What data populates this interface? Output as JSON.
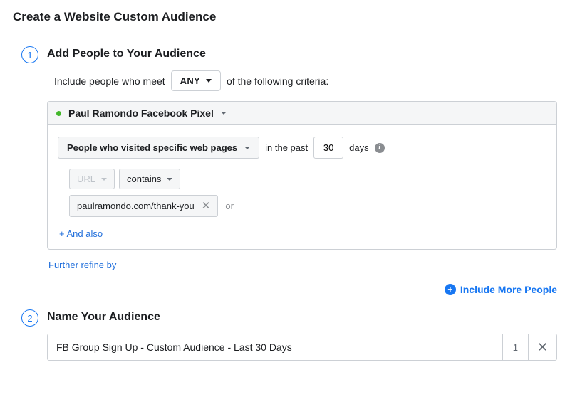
{
  "header": {
    "title": "Create a Website Custom Audience"
  },
  "step1": {
    "number": "1",
    "title": "Add People to Your Audience",
    "criteria": {
      "prefix": "Include people who meet",
      "match_mode": "ANY",
      "suffix": "of the following criteria:"
    },
    "source": {
      "name": "Paul Ramondo Facebook Pixel",
      "rule_type": "People who visited specific web pages",
      "past_prefix": "in the past",
      "days_value": "30",
      "days_label": "days",
      "url_field_label": "URL",
      "url_operator": "contains",
      "url_value": "paulramondo.com/thank-you",
      "or_label": "or",
      "and_also_label": "+ And also"
    },
    "refine_label": "Further refine by",
    "include_more_label": "Include More People"
  },
  "step2": {
    "number": "2",
    "title": "Name Your Audience",
    "name_value": "FB Group Sign Up - Custom Audience - Last 30 Days",
    "count": "1"
  }
}
